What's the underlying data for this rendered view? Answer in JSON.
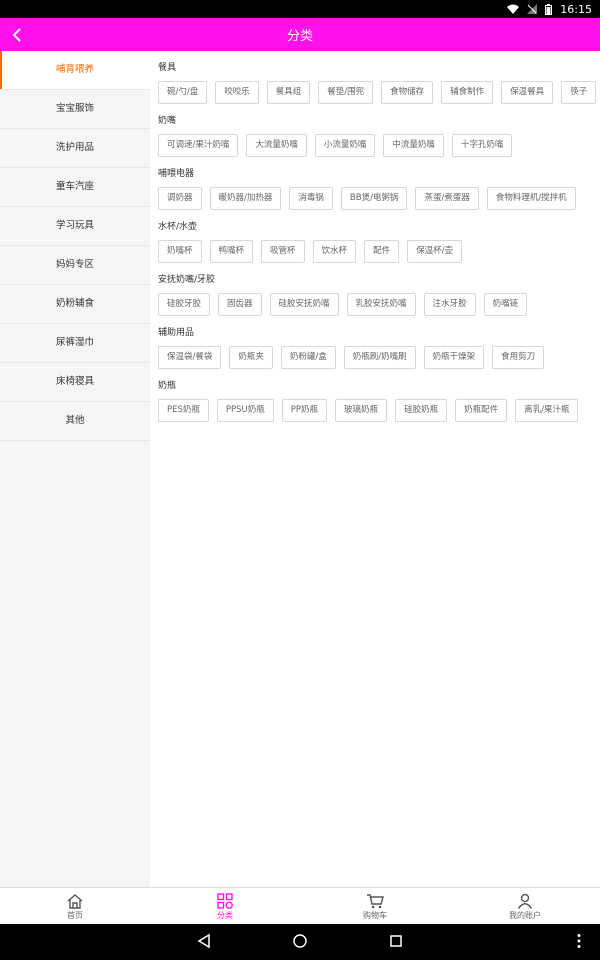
{
  "status_bar": {
    "time": "16:15"
  },
  "header": {
    "title": "分类"
  },
  "sidebar": {
    "items": [
      {
        "label": "哺育喂养",
        "active": true
      },
      {
        "label": "宝宝服饰"
      },
      {
        "label": "洗护用品"
      },
      {
        "label": "童车汽座"
      },
      {
        "label": "学习玩具"
      },
      {
        "label": "妈妈专区"
      },
      {
        "label": "奶粉辅食"
      },
      {
        "label": "尿裤湿巾"
      },
      {
        "label": "床椅寝具"
      },
      {
        "label": "其他"
      }
    ]
  },
  "sections": [
    {
      "title": "餐具",
      "tags": [
        "碗/勺/盘",
        "咬咬乐",
        "餐具组",
        "餐垫/围兜",
        "食物储存",
        "辅食制作",
        "保温餐具",
        "筷子"
      ]
    },
    {
      "title": "奶嘴",
      "tags": [
        "可调速/果汁奶嘴",
        "大流量奶嘴",
        "小流量奶嘴",
        "中流量奶嘴",
        "十字孔奶嘴"
      ]
    },
    {
      "title": "哺喂电器",
      "tags": [
        "调奶器",
        "暖奶器/加热器",
        "消毒锅",
        "BB煲/电粥锅",
        "蒸蛋/煮蛋器",
        "食物料理机/搅拌机"
      ]
    },
    {
      "title": "水杯/水壶",
      "tags": [
        "奶嘴杯",
        "鸭嘴杯",
        "吸管杯",
        "饮水杯",
        "配件",
        "保温杯/壶"
      ]
    },
    {
      "title": "安抚奶嘴/牙胶",
      "tags": [
        "硅胶牙胶",
        "固齿器",
        "硅胶安抚奶嘴",
        "乳胶安抚奶嘴",
        "注水牙胶",
        "奶嘴链"
      ]
    },
    {
      "title": "辅助用品",
      "tags": [
        "保温袋/餐袋",
        "奶瓶夹",
        "奶粉罐/盒",
        "奶瓶刷/奶嘴刷",
        "奶瓶干燥架",
        "食用剪刀"
      ]
    },
    {
      "title": "奶瓶",
      "tags": [
        "PES奶瓶",
        "PPSU奶瓶",
        "PP奶瓶",
        "玻璃奶瓶",
        "硅胶奶瓶",
        "奶瓶配件",
        "离乳/果汁瓶"
      ]
    }
  ],
  "bottom_nav": {
    "items": [
      {
        "label": "首页",
        "icon": "home-icon"
      },
      {
        "label": "分类",
        "icon": "category-icon",
        "active": true
      },
      {
        "label": "购物车",
        "icon": "cart-icon"
      },
      {
        "label": "我的账户",
        "icon": "user-icon"
      }
    ]
  },
  "colors": {
    "brand": "#ff11ee",
    "active_sidebar": "#ff6a00"
  }
}
